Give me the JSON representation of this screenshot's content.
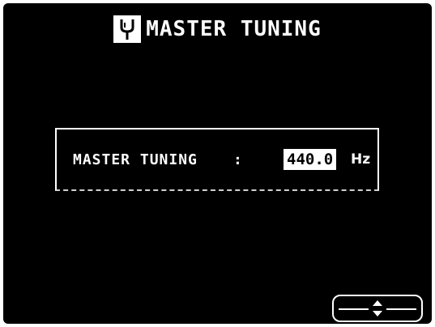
{
  "header": {
    "title": "MASTER TUNING",
    "icon": "tuning-fork-icon"
  },
  "setting": {
    "label": "MASTER TUNING",
    "separator": ":",
    "value": "440.0",
    "unit": "Hz"
  },
  "controls": {
    "scroll_icon": "up-down-arrow-icon"
  },
  "colors": {
    "background": "#000000",
    "foreground": "#ffffff"
  }
}
